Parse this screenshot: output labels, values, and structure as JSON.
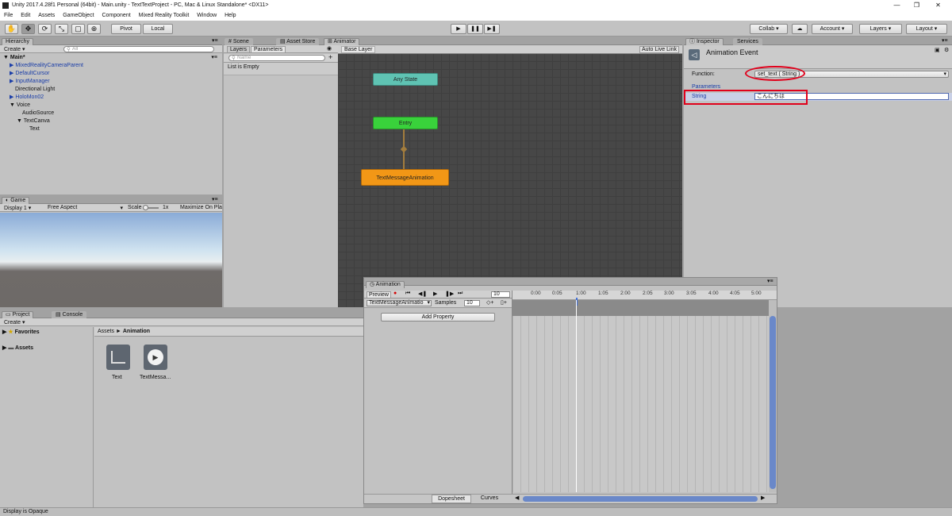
{
  "window": {
    "title": "Unity 2017.4.28f1 Personal (64bit) - Main.unity - TextTextProject - PC, Mac & Linux Standalone* <DX11>"
  },
  "menu": [
    "File",
    "Edit",
    "Assets",
    "GameObject",
    "Component",
    "Mixed Reality Toolkit",
    "Window",
    "Help"
  ],
  "toolbar": {
    "pivot": "Pivot",
    "local": "Local",
    "collab": "Collab ▾",
    "account": "Account",
    "layers": "Layers",
    "layout": "Layout"
  },
  "hierarchy": {
    "tab": "Hierarchy",
    "create": "Create",
    "search_placeholder": "All",
    "scene": "Main*",
    "items": [
      "MixedRealityCameraParent",
      "DefaultCursor",
      "InputManager",
      "Directional Light",
      "HoloMon02",
      "Voice",
      "AudioSource",
      "TextCanva",
      "Text"
    ]
  },
  "game": {
    "tab": "Game",
    "display": "Display 1",
    "aspect": "Free Aspect",
    "scale_label": "Scale",
    "scale_value": "1x",
    "maximize": "Maximize On Pla"
  },
  "project": {
    "tab": "Project",
    "console_tab": "Console",
    "create": "Create",
    "favorites": "Favorites",
    "assets": "Assets",
    "breadcrumb_root": "Assets",
    "breadcrumb_sep": "►",
    "breadcrumb_current": "Animation",
    "files": [
      {
        "name": "Text"
      },
      {
        "name": "TextMessa..."
      }
    ]
  },
  "animator": {
    "tabs": [
      "Scene",
      "Asset Store",
      "Animator"
    ],
    "sub_tabs": [
      "Layers",
      "Parameters"
    ],
    "search_placeholder": "Name",
    "list_empty": "List is Empty",
    "layer": "Base Layer",
    "auto_live_link": "Auto Live Link",
    "states": {
      "any": "Any State",
      "entry": "Entry",
      "anim": "TextMessageAnimation"
    }
  },
  "inspector": {
    "tab": "Inspector",
    "services_tab": "Services",
    "title": "Animation Event",
    "function_label": "Function:",
    "function_value": "set_text ( String )",
    "parameters_label": "Parameters",
    "string_label": "String",
    "string_value": "こんにちは"
  },
  "animation": {
    "tab": "Animation",
    "preview": "Preview",
    "frame": "10",
    "clip": "TextMessageAnimatio",
    "samples_label": "Samples",
    "samples_value": "10",
    "add_property": "Add Property",
    "dopesheet": "Dopesheet",
    "curves": "Curves",
    "ticks": [
      "0:00",
      "0:05",
      "1:00",
      "1:05",
      "2:00",
      "2:05",
      "3:00",
      "3:05",
      "4:00",
      "4:05",
      "5:00"
    ]
  },
  "status": "Display is Opaque",
  "colors": {
    "any_state": "#5fc3b3",
    "entry": "#39d23b",
    "anim_state": "#f29716",
    "highlight": "#e0001b",
    "link": "#1b3ea8"
  }
}
